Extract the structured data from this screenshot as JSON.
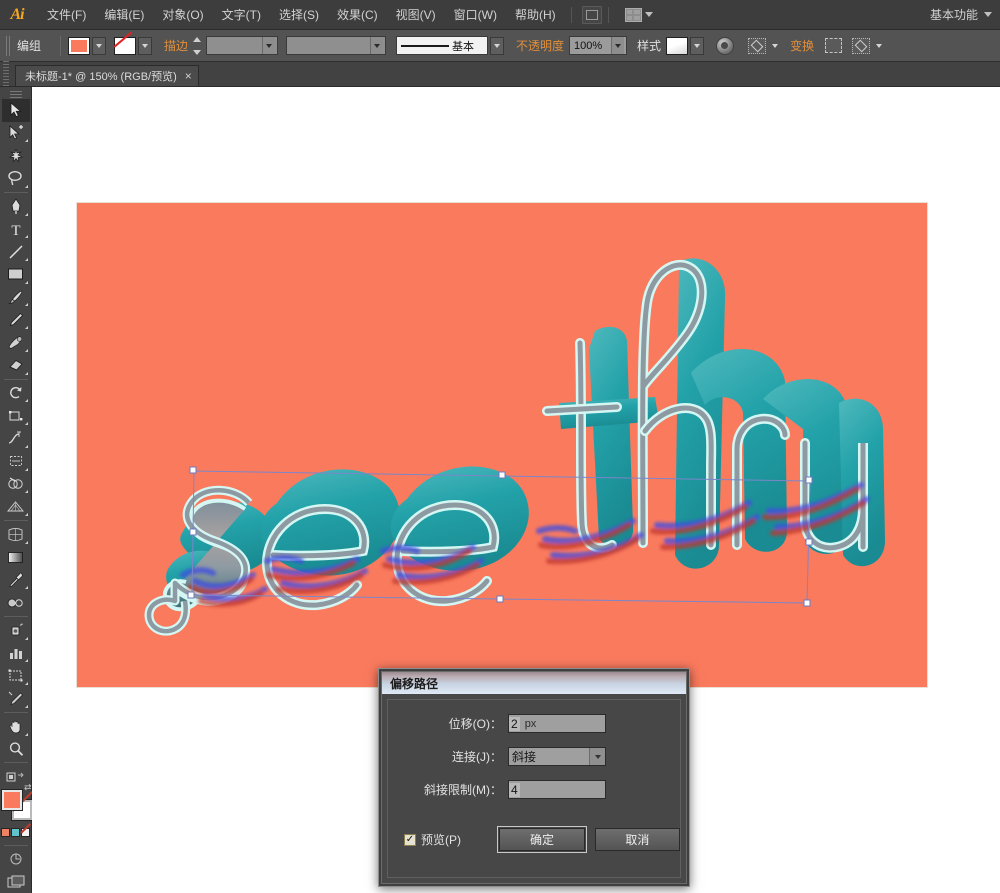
{
  "app": {
    "logo": "Ai",
    "workspace_label": "基本功能"
  },
  "menubar": {
    "items": [
      {
        "label": "文件(F)"
      },
      {
        "label": "编辑(E)"
      },
      {
        "label": "对象(O)"
      },
      {
        "label": "文字(T)"
      },
      {
        "label": "选择(S)"
      },
      {
        "label": "效果(C)"
      },
      {
        "label": "视图(V)"
      },
      {
        "label": "窗口(W)"
      },
      {
        "label": "帮助(H)"
      }
    ],
    "bridge_icon": "bridge-icon",
    "arrange_icon": "arrange-documents-icon"
  },
  "controlbar": {
    "selection_label": "编组",
    "fill_color": "#FA7A5E",
    "stroke_value": "无",
    "stroke_label": "描边",
    "stroke_weight": "",
    "profile_value": "",
    "brush_definition": "基本",
    "opacity_label": "不透明度",
    "opacity_value": "100%",
    "style_label": "样式",
    "transform_label": "变换",
    "icons": {
      "recolor": "recolor-artwork-icon",
      "mask": "opacity-mask-icon",
      "align": "align-icon",
      "shape": "shape-options-icon"
    }
  },
  "tabbar": {
    "doc_title": "未标题-1* @ 150% (RGB/预览)",
    "close_glyph": "×"
  },
  "toolbar": {
    "tools": [
      {
        "name": "selection-tool",
        "active": true
      },
      {
        "name": "direct-selection-tool",
        "active": false
      },
      {
        "name": "magic-wand-tool",
        "active": false
      },
      {
        "name": "lasso-tool",
        "active": false
      },
      {
        "name": "pen-tool",
        "active": false
      },
      {
        "name": "type-tool",
        "active": false
      },
      {
        "name": "line-segment-tool",
        "active": false
      },
      {
        "name": "rectangle-tool",
        "active": false
      },
      {
        "name": "paintbrush-tool",
        "active": false
      },
      {
        "name": "pencil-tool",
        "active": false
      },
      {
        "name": "blob-brush-tool",
        "active": false
      },
      {
        "name": "eraser-tool",
        "active": false
      },
      {
        "name": "rotate-tool",
        "active": false
      },
      {
        "name": "scale-tool",
        "active": false
      },
      {
        "name": "width-tool",
        "active": false
      },
      {
        "name": "free-transform-tool",
        "active": false
      },
      {
        "name": "shape-builder-tool",
        "active": false
      },
      {
        "name": "perspective-grid-tool",
        "active": false
      },
      {
        "name": "mesh-tool",
        "active": false
      },
      {
        "name": "gradient-tool",
        "active": false
      },
      {
        "name": "eyedropper-tool",
        "active": false
      },
      {
        "name": "blend-tool",
        "active": false
      },
      {
        "name": "symbol-sprayer-tool",
        "active": false
      },
      {
        "name": "column-graph-tool",
        "active": false
      },
      {
        "name": "artboard-tool",
        "active": false
      },
      {
        "name": "slice-tool",
        "active": false
      },
      {
        "name": "hand-tool",
        "active": false
      },
      {
        "name": "zoom-tool",
        "active": false
      }
    ],
    "fill_color": "#FA7A5E",
    "stroke_color": "none",
    "mini_swatches": [
      "#F08262",
      "#5FC4CC",
      "#F3F3F3"
    ]
  },
  "artwork": {
    "text": "see thru",
    "background_color": "#FA7A5E",
    "letter_color": "#20A0A8",
    "letter_shadow_color": "#18848C",
    "highlight_color": "#CFF6F4",
    "offset_preview_color_a": "#4255E0",
    "offset_preview_color_b": "#C0392B",
    "selection_color": "#7B86C9"
  },
  "dialog": {
    "title": "偏移路径",
    "fields": [
      {
        "label": "位移(O)：",
        "value": "2",
        "unit": "px",
        "name": "offset-field"
      },
      {
        "label": "连接(J)：",
        "value": "斜接",
        "unit": "",
        "name": "join-select"
      },
      {
        "label": "斜接限制(M)：",
        "value": "4",
        "unit": "",
        "name": "miter-limit-field"
      }
    ],
    "preview_label": "预览(P)",
    "preview_checked": true,
    "check_glyph": "✓",
    "ok_label": "确定",
    "cancel_label": "取消"
  }
}
